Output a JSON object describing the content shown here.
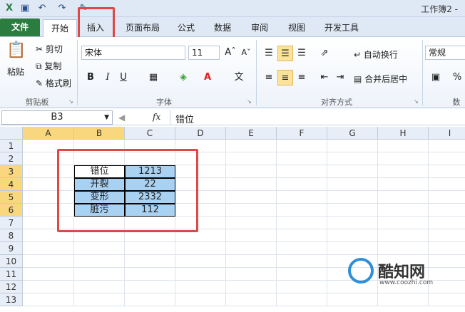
{
  "window": {
    "title": "工作簿2 -"
  },
  "quick_access": {
    "icons": [
      "excel-icon",
      "save-icon",
      "undo-icon",
      "redo-icon",
      "format-painter-icon"
    ]
  },
  "tabs": [
    {
      "label": "文件"
    },
    {
      "label": "开始"
    },
    {
      "label": "插入"
    },
    {
      "label": "页面布局"
    },
    {
      "label": "公式"
    },
    {
      "label": "数据"
    },
    {
      "label": "审阅"
    },
    {
      "label": "视图"
    },
    {
      "label": "开发工具"
    }
  ],
  "ribbon": {
    "clipboard": {
      "paste": "粘贴",
      "cut": "剪切",
      "copy": "复制",
      "format_painter": "格式刷",
      "label": "剪贴板"
    },
    "font": {
      "name": "宋体",
      "size": "11",
      "label": "字体",
      "bold": "B",
      "italic": "I",
      "underline": "U"
    },
    "align": {
      "wrap": "自动换行",
      "merge": "合并后居中",
      "label": "对齐方式"
    },
    "number": {
      "format": "常规",
      "label": "数",
      "percent": "%"
    },
    "colors": {
      "accent": "#2a7c3f",
      "highlight": "#e04848",
      "selected": "#a9d1f2"
    }
  },
  "formula_bar": {
    "name_box": "B3",
    "fx": "fx",
    "value": "错位"
  },
  "grid": {
    "columns": [
      "A",
      "B",
      "C",
      "D",
      "E",
      "F",
      "G",
      "H",
      "I"
    ],
    "rows": [
      "1",
      "2",
      "3",
      "4",
      "5",
      "6",
      "7",
      "8",
      "9",
      "10",
      "11",
      "12",
      "13"
    ],
    "table": [
      {
        "label": "错位",
        "value": "1213"
      },
      {
        "label": "开裂",
        "value": "22"
      },
      {
        "label": "变形",
        "value": "2332"
      },
      {
        "label": "脏污",
        "value": "112"
      }
    ]
  },
  "watermark": {
    "text": "酷知网",
    "url": "www.coozhi.com"
  }
}
